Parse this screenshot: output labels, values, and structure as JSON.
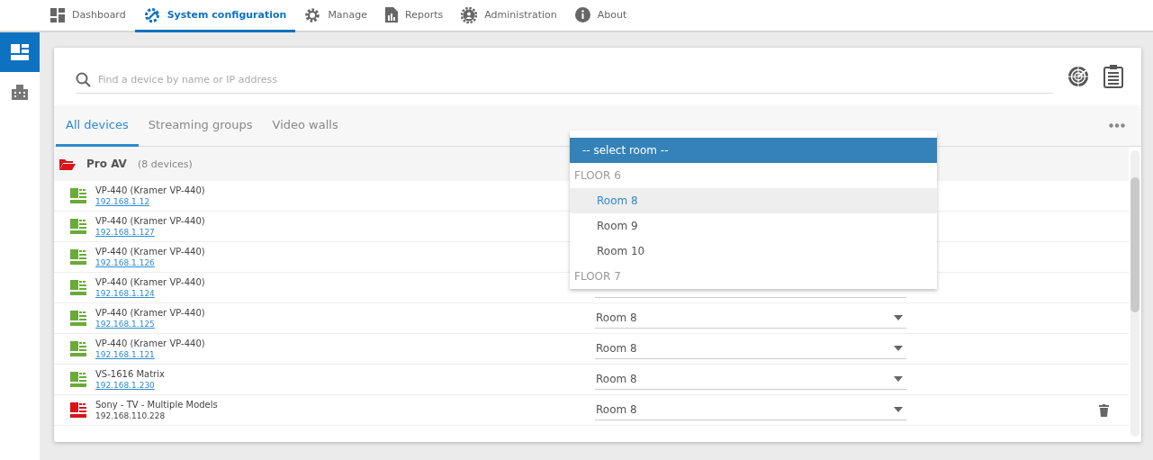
{
  "nav": [
    {
      "label": "Dashboard",
      "selected": false
    },
    {
      "label": "System configuration",
      "selected": true
    },
    {
      "label": "Manage",
      "selected": false
    },
    {
      "label": "Reports",
      "selected": false
    },
    {
      "label": "Administration",
      "selected": false
    },
    {
      "label": "About",
      "selected": false
    }
  ],
  "sidebar": [
    {
      "selected": true
    },
    {
      "selected": false
    }
  ],
  "search": {
    "placeholder": "Find a device by name or IP address"
  },
  "tabs": [
    {
      "label": "All devices",
      "selected": true
    },
    {
      "label": "Streaming groups",
      "selected": false
    },
    {
      "label": "Video walls",
      "selected": false
    }
  ],
  "group": {
    "name": "Pro AV",
    "count": "(8 devices)"
  },
  "devices": [
    {
      "name": "VP-440 (Kramer VP-440)",
      "ip": "192.168.1.12",
      "error": false,
      "deletable": false
    },
    {
      "name": "VP-440 (Kramer VP-440)",
      "ip": "192.168.1.127",
      "error": false,
      "deletable": false
    },
    {
      "name": "VP-440 (Kramer VP-440)",
      "ip": "192.168.1.126",
      "error": false,
      "deletable": false
    },
    {
      "name": "VP-440 (Kramer VP-440)",
      "ip": "192.168.1.124",
      "error": false,
      "deletable": false
    },
    {
      "name": "VP-440 (Kramer VP-440)",
      "ip": "192.168.1.125",
      "error": false,
      "room": "Room 8",
      "deletable": false
    },
    {
      "name": "VP-440 (Kramer VP-440)",
      "ip": "192.168.1.121",
      "error": false,
      "room": "Room 8",
      "deletable": false
    },
    {
      "name": "VS-1616 Matrix",
      "ip": "192.168.1.230",
      "error": false,
      "room": "Room 8",
      "deletable": false
    },
    {
      "name": "Sony - TV - Multiple Models",
      "ip": "192.168.110.228",
      "error": true,
      "room": "Room 8",
      "deletable": true
    }
  ],
  "dropdown": {
    "items": [
      {
        "kind": "header",
        "label": "-- select room --"
      },
      {
        "kind": "group",
        "label": "FLOOR 6"
      },
      {
        "kind": "option",
        "label": "Room 8",
        "selected": true
      },
      {
        "kind": "option",
        "label": "Room 9",
        "selected": false
      },
      {
        "kind": "option",
        "label": "Room 10",
        "selected": false
      },
      {
        "kind": "group",
        "label": "FLOOR 7"
      }
    ]
  }
}
